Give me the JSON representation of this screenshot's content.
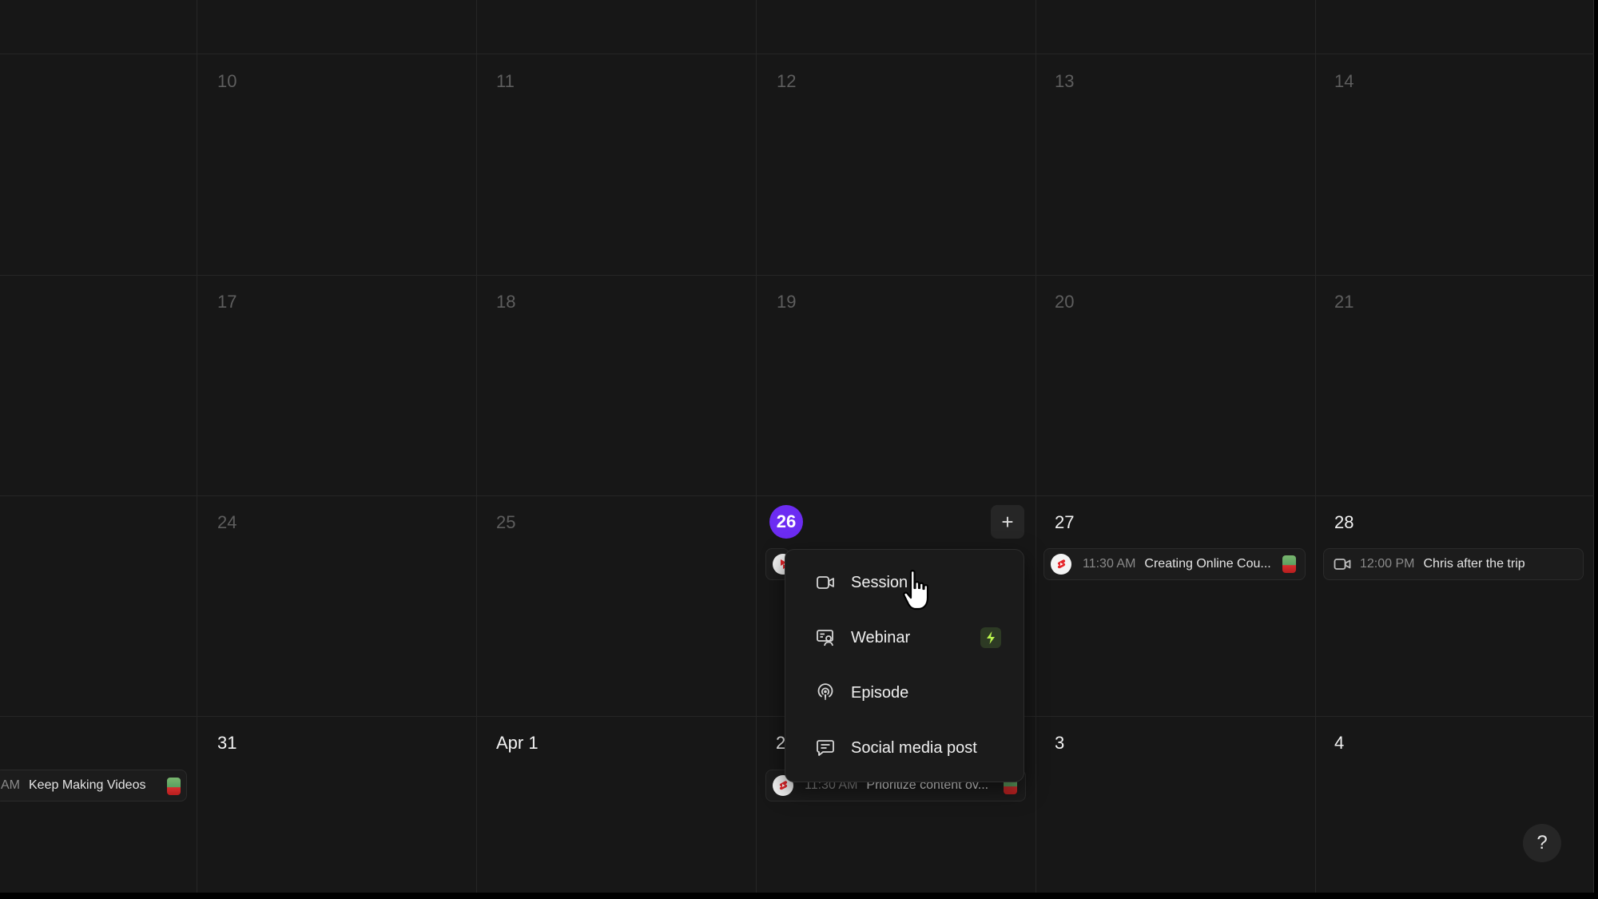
{
  "calendar": {
    "week2": [
      "10",
      "11",
      "12",
      "13",
      "14"
    ],
    "week3": [
      "17",
      "18",
      "19",
      "20",
      "21"
    ],
    "week4": [
      "24",
      "25",
      "26",
      "27",
      "28"
    ],
    "week5": [
      "31",
      "Apr 1",
      "2",
      "3",
      "4"
    ],
    "today": "26",
    "add_label": "+"
  },
  "events": {
    "mon_partial": {
      "time": "AM",
      "title": "Keep Making Videos"
    },
    "thu_27": {
      "time": "11:30 AM",
      "title": "Creating Online Cou..."
    },
    "fri_28": {
      "time": "12:00 PM",
      "title": "Chris after the trip"
    },
    "wed_2": {
      "time": "11:30 AM",
      "title": "Prioritize content ov..."
    }
  },
  "menu": {
    "items": [
      {
        "label": "Session",
        "icon": "video-camera-icon"
      },
      {
        "label": "Webinar",
        "icon": "webinar-presentation-icon",
        "badge": "lightning-icon"
      },
      {
        "label": "Episode",
        "icon": "podcast-icon"
      },
      {
        "label": "Social media post",
        "icon": "chat-bubble-icon"
      }
    ]
  },
  "help": {
    "label": "?"
  },
  "colors": {
    "accent": "#6c2cf2",
    "background": "#171717",
    "grid": "#262626",
    "bolt": "#b8f34c",
    "youtube_red": "#e5252a"
  }
}
